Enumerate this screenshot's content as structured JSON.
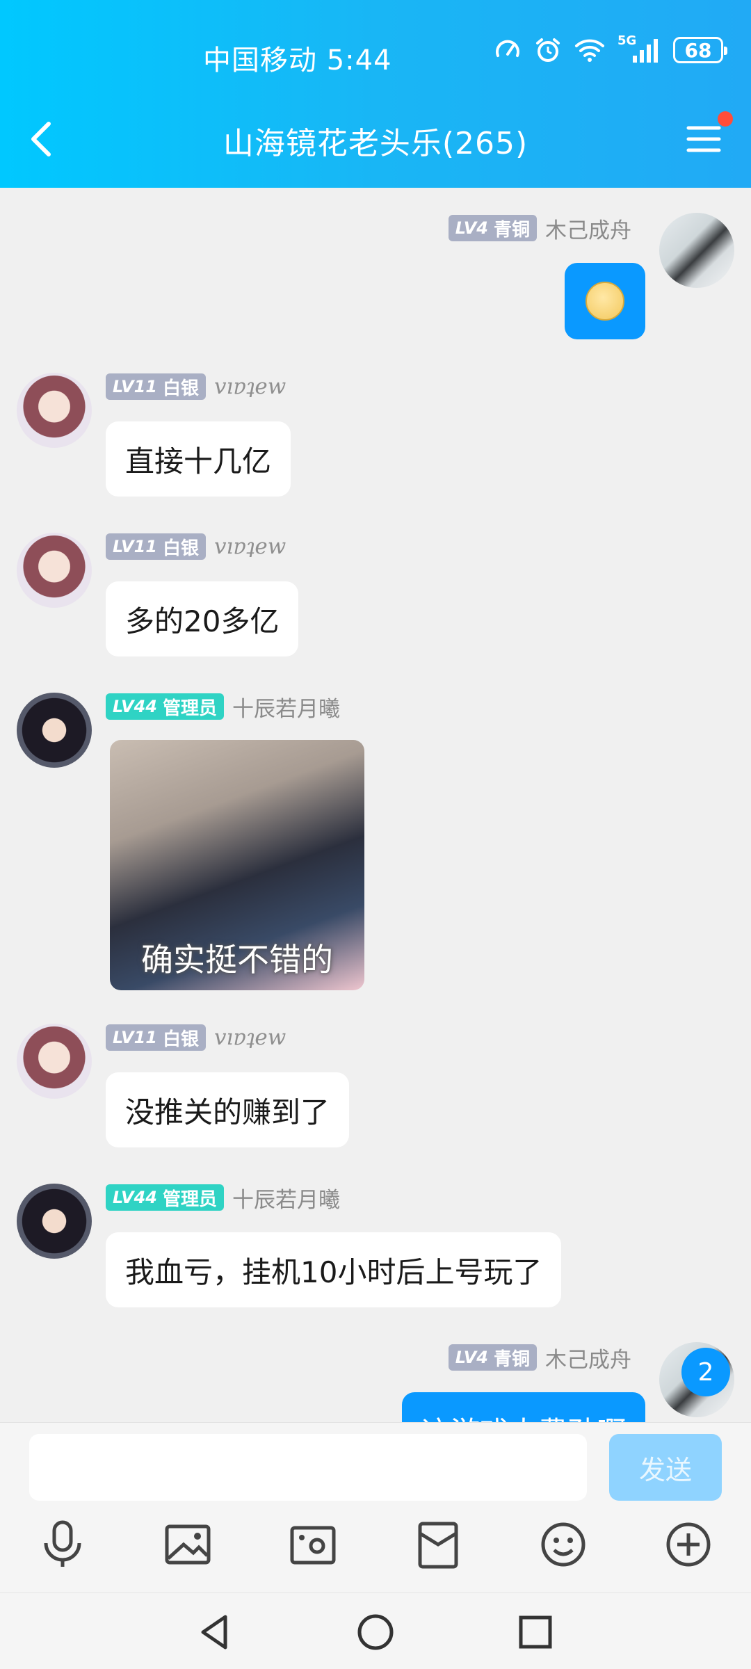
{
  "status_bar": {
    "carrier": "中国移动",
    "time": "5:44",
    "network": "5G",
    "battery": "68"
  },
  "header": {
    "title": "山海镜花老头乐(265)"
  },
  "messages": [
    {
      "sender": "木己成舟",
      "level": "LV4",
      "rank": "青铜",
      "side": "right",
      "type": "emoji"
    },
    {
      "sender": "vıɐʇew",
      "level": "LV11",
      "rank": "白银",
      "side": "left",
      "text": "直接十几亿"
    },
    {
      "sender": "vıɐʇew",
      "level": "LV11",
      "rank": "白银",
      "side": "left",
      "text": "多的20多亿"
    },
    {
      "sender": "十辰若月曦",
      "level": "LV44",
      "rank": "管理员",
      "side": "left",
      "type": "sticker",
      "caption": "确实挺不错的"
    },
    {
      "sender": "vıɐʇew",
      "level": "LV11",
      "rank": "白银",
      "side": "left",
      "text": "没推关的赚到了"
    },
    {
      "sender": "十辰若月曦",
      "level": "LV44",
      "rank": "管理员",
      "side": "left",
      "text": "我血亏，挂机10小时后上号玩了"
    },
    {
      "sender": "木己成舟",
      "level": "LV4",
      "rank": "青铜",
      "side": "right",
      "text": "这游戏太费劲啊"
    }
  ],
  "unread_count": "2",
  "composer": {
    "input_value": "",
    "send_label": "发送"
  },
  "toolbar_icons": [
    "microphone-icon",
    "image-icon",
    "camera-icon",
    "red-packet-icon",
    "emoji-icon",
    "plus-icon"
  ],
  "colors": {
    "header_start": "#00c8ff",
    "header_end": "#21aaf5",
    "accent_blue": "#0a99ff",
    "admin_badge": "#2fd3c4",
    "level_badge": "#a9afc4",
    "notification_dot": "#ff4d3a"
  }
}
